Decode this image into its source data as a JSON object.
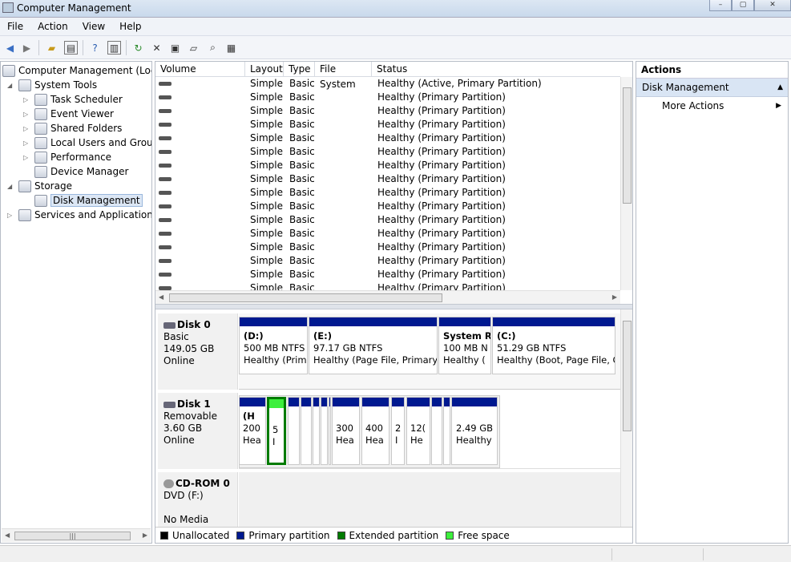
{
  "window": {
    "title": "Computer Management",
    "controls": {
      "minimize": "–",
      "maximize": "▢",
      "close": "✕"
    }
  },
  "menu": [
    "File",
    "Action",
    "View",
    "Help"
  ],
  "toolbar_icons": [
    "back-icon",
    "forward-icon",
    "up-folder-icon",
    "show-hide-tree-icon",
    "help-icon",
    "show-hide-action-pane-icon",
    "refresh-icon",
    "delete-icon",
    "properties-icon",
    "open-icon",
    "search-icon",
    "settings-icon"
  ],
  "tree": [
    {
      "label": "Computer Management (Local",
      "level": 0,
      "expander": "",
      "icon": "computer-icon"
    },
    {
      "label": "System Tools",
      "level": 1,
      "expander": "◢",
      "icon": "tools-icon"
    },
    {
      "label": "Task Scheduler",
      "level": 2,
      "expander": "▷",
      "icon": "clock-icon"
    },
    {
      "label": "Event Viewer",
      "level": 2,
      "expander": "▷",
      "icon": "event-viewer-icon"
    },
    {
      "label": "Shared Folders",
      "level": 2,
      "expander": "▷",
      "icon": "shared-folder-icon"
    },
    {
      "label": "Local Users and Groups",
      "level": 2,
      "expander": "▷",
      "icon": "users-icon"
    },
    {
      "label": "Performance",
      "level": 2,
      "expander": "▷",
      "icon": "performance-icon"
    },
    {
      "label": "Device Manager",
      "level": 2,
      "expander": "",
      "icon": "device-manager-icon"
    },
    {
      "label": "Storage",
      "level": 1,
      "expander": "◢",
      "icon": "storage-icon"
    },
    {
      "label": "Disk Management",
      "level": 2,
      "expander": "",
      "icon": "disk-management-icon",
      "selected": true
    },
    {
      "label": "Services and Applications",
      "level": 1,
      "expander": "▷",
      "icon": "services-icon"
    }
  ],
  "volume_table": {
    "headers": [
      "Volume",
      "Layout",
      "Type",
      "File System",
      "Status"
    ],
    "rows": [
      {
        "layout": "Simple",
        "type": "Basic",
        "status": "Healthy (Active, Primary Partition)"
      },
      {
        "layout": "Simple",
        "type": "Basic",
        "status": "Healthy (Primary Partition)"
      },
      {
        "layout": "Simple",
        "type": "Basic",
        "status": "Healthy (Primary Partition)"
      },
      {
        "layout": "Simple",
        "type": "Basic",
        "status": "Healthy (Primary Partition)"
      },
      {
        "layout": "Simple",
        "type": "Basic",
        "status": "Healthy (Primary Partition)"
      },
      {
        "layout": "Simple",
        "type": "Basic",
        "status": "Healthy (Primary Partition)"
      },
      {
        "layout": "Simple",
        "type": "Basic",
        "status": "Healthy (Primary Partition)"
      },
      {
        "layout": "Simple",
        "type": "Basic",
        "status": "Healthy (Primary Partition)"
      },
      {
        "layout": "Simple",
        "type": "Basic",
        "status": "Healthy (Primary Partition)"
      },
      {
        "layout": "Simple",
        "type": "Basic",
        "status": "Healthy (Primary Partition)"
      },
      {
        "layout": "Simple",
        "type": "Basic",
        "status": "Healthy (Primary Partition)"
      },
      {
        "layout": "Simple",
        "type": "Basic",
        "status": "Healthy (Primary Partition)"
      },
      {
        "layout": "Simple",
        "type": "Basic",
        "status": "Healthy (Primary Partition)"
      },
      {
        "layout": "Simple",
        "type": "Basic",
        "status": "Healthy (Primary Partition)"
      },
      {
        "layout": "Simple",
        "type": "Basic",
        "status": "Healthy (Primary Partition)"
      },
      {
        "layout": "Simple",
        "type": "Basic",
        "status": "Healthy (Primary Partition)"
      }
    ]
  },
  "disks": [
    {
      "name": "Disk 0",
      "kind": "Basic",
      "size": "149.05 GB",
      "state": "Online",
      "partitions": [
        {
          "name": "(D:)",
          "line1": "500 MB NTFS",
          "line2": "Healthy (Prim"
        },
        {
          "name": "(E:)",
          "line1": "97.17 GB NTFS",
          "line2": "Healthy (Page File, Primary I"
        },
        {
          "name": "System R",
          "line1": "100 MB N",
          "line2": "Healthy ("
        },
        {
          "name": "(C:)",
          "line1": "51.29 GB NTFS",
          "line2": "Healthy (Boot, Page File, C"
        }
      ]
    },
    {
      "name": "Disk 1",
      "kind": "Removable",
      "size": "3.60 GB",
      "state": "Online",
      "partitions": [
        {
          "name": "(H",
          "line1": "200",
          "line2": "Hea"
        },
        {
          "name": "",
          "line1": "5",
          "line2": "I"
        },
        {
          "name": "",
          "line1": "",
          "line2": ""
        },
        {
          "name": "",
          "line1": "",
          "line2": ""
        },
        {
          "name": "",
          "line1": "",
          "line2": ""
        },
        {
          "name": "",
          "line1": "",
          "line2": ""
        },
        {
          "name": "",
          "line1": "",
          "line2": ""
        },
        {
          "name": "",
          "line1": "300",
          "line2": "Hea"
        },
        {
          "name": "",
          "line1": "400",
          "line2": "Hea"
        },
        {
          "name": "",
          "line1": "2",
          "line2": "I"
        },
        {
          "name": "",
          "line1": "12(",
          "line2": "He"
        },
        {
          "name": "",
          "line1": "",
          "line2": ""
        },
        {
          "name": "",
          "line1": "",
          "line2": ""
        },
        {
          "name": "",
          "line1": "2.49 GB",
          "line2": "Healthy"
        }
      ]
    },
    {
      "name": "CD-ROM 0",
      "kind": "DVD (F:)",
      "size": "",
      "state": "No Media"
    }
  ],
  "legend": [
    {
      "label": "Unallocated",
      "color": "#000000"
    },
    {
      "label": "Primary partition",
      "color": "#001990"
    },
    {
      "label": "Extended partition",
      "color": "#007b00"
    },
    {
      "label": "Free space",
      "color": "#3cef3c"
    }
  ],
  "actions": {
    "title": "Actions",
    "section": "Disk Management",
    "more": "More Actions"
  }
}
